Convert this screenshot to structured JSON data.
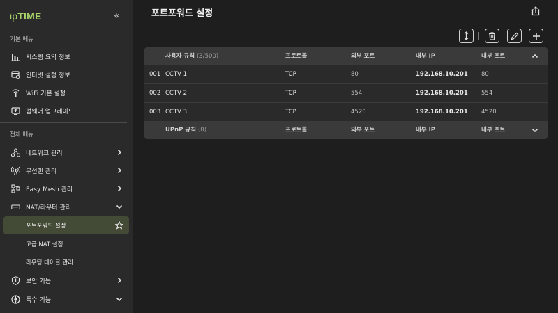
{
  "brand": {
    "logo_prefix": "ip",
    "logo_main": "TIME"
  },
  "sidebar": {
    "basic_section": "기본 메뉴",
    "basic_items": [
      {
        "label": "시스템 요약 정보",
        "icon": "bar-chart-icon"
      },
      {
        "label": "인터넷 설정 정보",
        "icon": "internet-settings-icon"
      },
      {
        "label": "WiFi 기본 설정",
        "icon": "wifi-icon"
      },
      {
        "label": "펌웨어 업그레이드",
        "icon": "firmware-upgrade-icon"
      }
    ],
    "full_section": "전체 메뉴",
    "full_items": [
      {
        "label": "네트워크 관리",
        "icon": "network-icon",
        "expanded": false
      },
      {
        "label": "무선랜 관리",
        "icon": "wireless-icon",
        "expanded": false
      },
      {
        "label": "Easy Mesh 관리",
        "icon": "mesh-icon",
        "expanded": false
      },
      {
        "label": "NAT/라우터 관리",
        "icon": "router-icon",
        "expanded": true
      }
    ],
    "nat_subitems": [
      {
        "label": "포트포워드 설정",
        "active": true
      },
      {
        "label": "고급 NAT 설정",
        "active": false
      },
      {
        "label": "라우팅 테이블 관리",
        "active": false
      }
    ],
    "bottom_items": [
      {
        "label": "보안 기능",
        "icon": "shield-icon",
        "expanded": false
      },
      {
        "label": "특수 기능",
        "icon": "special-function-icon",
        "expanded": true
      }
    ]
  },
  "page": {
    "title": "포트포워드 설정"
  },
  "table": {
    "user_rules": {
      "label": "사용자 규칙",
      "count": "(3/500)",
      "columns": {
        "protocol": "프로토콜",
        "external_port": "외부 포트",
        "internal_ip": "내부 IP",
        "internal_port": "내부 포트"
      },
      "rows": [
        {
          "no": "001",
          "name": "CCTV 1",
          "protocol": "TCP",
          "external_port": "80",
          "internal_ip": "192.168.10.201",
          "internal_port": "80"
        },
        {
          "no": "002",
          "name": "CCTV 2",
          "protocol": "TCP",
          "external_port": "554",
          "internal_ip": "192.168.10.201",
          "internal_port": "554"
        },
        {
          "no": "003",
          "name": "CCTV 3",
          "protocol": "TCP",
          "external_port": "4520",
          "internal_ip": "192.168.10.201",
          "internal_port": "4520"
        }
      ]
    },
    "upnp_rules": {
      "label": "UPnP 규칙",
      "count": "(0)",
      "columns": {
        "protocol": "프로토콜",
        "external_port": "외부 포트",
        "internal_ip": "내부 IP",
        "internal_port": "내부 포트"
      }
    }
  },
  "colors": {
    "accent": "#a9d46a",
    "active_bg": "#434a36"
  }
}
